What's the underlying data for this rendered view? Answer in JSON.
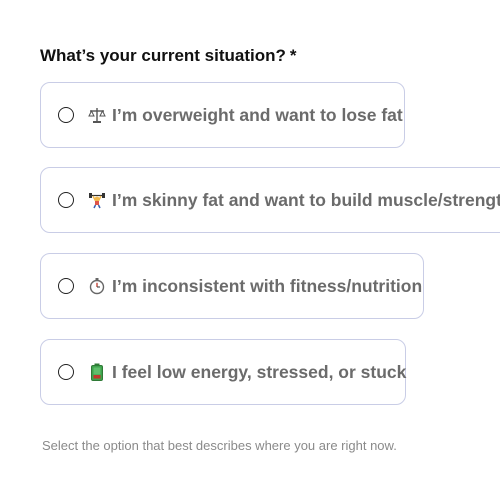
{
  "question": {
    "label": "What’s your current situation?",
    "required_mark": "*"
  },
  "options": [
    {
      "icon": "balance-scale-icon",
      "label": "I’m overweight and want to lose fat"
    },
    {
      "icon": "weightlifter-icon",
      "label": "I’m skinny fat and want to build muscle/strength"
    },
    {
      "icon": "stopwatch-icon",
      "label": "I’m inconsistent with fitness/nutrition"
    },
    {
      "icon": "battery-low-icon",
      "label": "I feel low energy, stressed, or stuck"
    }
  ],
  "hint": "Select the option that best describes where you are right now.",
  "colors": {
    "option_border": "#c9cde6",
    "option_text": "#6b6b6b",
    "question_text": "#111111",
    "hint_text": "#8a8a8a"
  }
}
